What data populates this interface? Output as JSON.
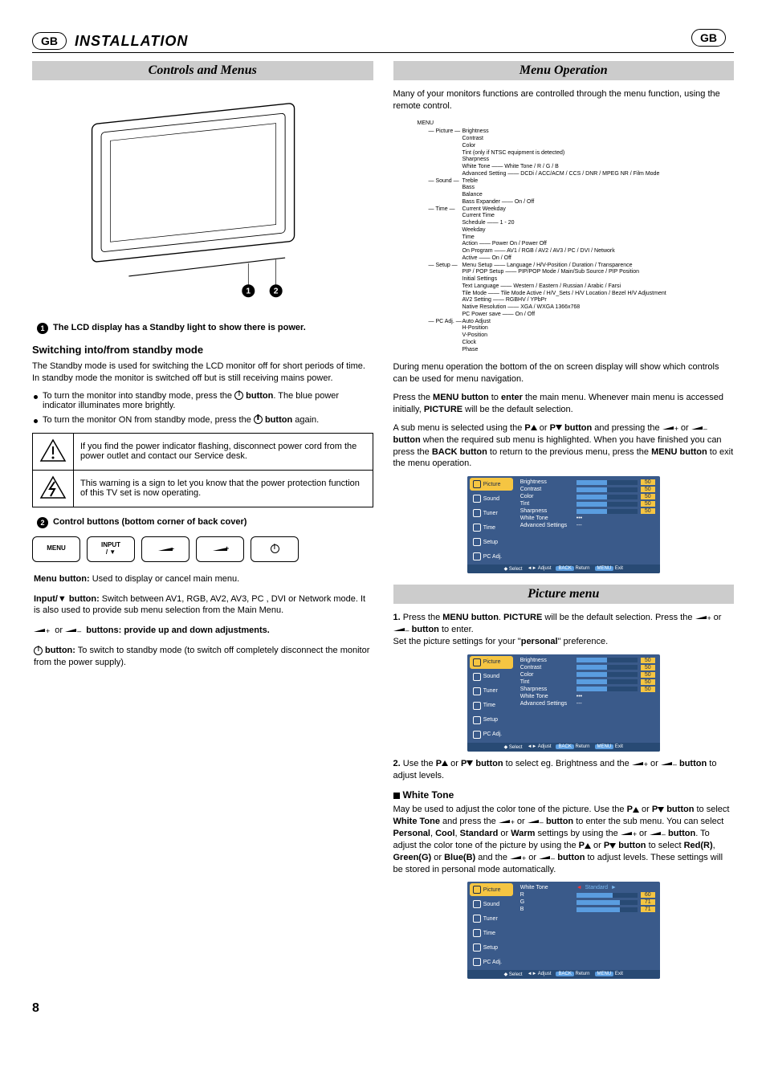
{
  "header": {
    "badge": "GB",
    "title": "INSTALLATION",
    "badge_right": "GB"
  },
  "left": {
    "band": "Controls and Menus",
    "callout1": "The LCD display has a Standby light to show there is power.",
    "sub1": "Switching into/from standby mode",
    "p1": "The Standby mode is used for switching the LCD monitor off for short periods of time. In standby mode the monitor is switched off but is still receiving mains power.",
    "b1a": "To turn the monitor into standby mode, press the ",
    "b1b": " button",
    "b1c": ". The blue power indicator illuminates more brightly.",
    "b2a": "To turn the monitor ON from standby mode, press the ",
    "b2b": " button",
    "b2c": " again.",
    "warn1": "If you find the power indicator flashing, disconnect power cord from the power outlet and contact our Service desk.",
    "warn2": "This warning is a sign to let you know that the power protection function of this TV set is now operating.",
    "callout2": "Control buttons (bottom corner of back cover)",
    "btn_menu": "MENU",
    "btn_input": "INPUT\n/ ▼",
    "d1l": "Menu button:",
    "d1t": " Used to display or cancel main menu.",
    "d2l": "Input/▼ button:",
    "d2t": " Switch between AV1, RGB, AV2, AV3, PC , DVI or Network mode. It is also used to provide sub menu selection from the Main Menu.",
    "d3t": " buttons: provide up and down adjustments.",
    "d4l": " button:",
    "d4t": " To switch to standby mode (to switch off completely disconnect the monitor from the power supply)."
  },
  "right": {
    "band1": "Menu Operation",
    "intro": "Many of your monitors functions are controlled through the menu function, using the remote control.",
    "tree": {
      "root": "MENU",
      "picture": {
        "label": "Picture",
        "items": [
          "Brightness",
          "Contrast",
          "Color",
          "Tint (only if NTSC equipment is detected)",
          "Sharpness",
          "White Tone —— White Tone / R / G / B",
          "Advanced Setting —— DCDi / ACC/ACM / CCS / DNR / MPEG NR / Film Mode"
        ]
      },
      "sound": {
        "label": "Sound",
        "items": [
          "Treble",
          "Bass",
          "Balance",
          "Bass Expander —— On / Off"
        ]
      },
      "time": {
        "label": "Time",
        "items": [
          "Current Weekday",
          "Current Time",
          "Schedule —— 1 - 20",
          "Weekday",
          "Time",
          "Action —— Power On / Power Off",
          "On Program —— AV1 / RGB / AV2 / AV3 / PC / DVI / Network",
          "Active —— On / Off"
        ]
      },
      "setup": {
        "label": "Setup",
        "items": [
          "Menu Setup —— Language / H/V-Position / Duration / Transparence",
          "PIP / POP Setup —— PIP/POP Mode / Main/Sub Source / PIP Position",
          "Initial Settings",
          "Text Language —— Western / Eastern / Russian / Arabic / Farsi",
          "Tile Mode —— Tile Mode Active / H/V_Sets / H/V Location / Bezel H/V Adjustment",
          "AV2 Setting —— RGBHV / YPbPr",
          "Native Resolution —— XGA / WXGA 1366x768",
          "PC Power save —— On / Off"
        ]
      },
      "pcadj": {
        "label": "PC Adj.",
        "items": [
          "Auto Adjust",
          "H-Position",
          "V-Position",
          "Clock",
          "Phase"
        ]
      }
    },
    "after_tree1": "During menu operation the bottom of the on screen display will show which controls can be used for menu navigation.",
    "after_tree2a": "Press the ",
    "after_tree2b": "MENU button",
    "after_tree2c": " to ",
    "after_tree2d": "enter",
    "after_tree2e": " the main menu. Whenever main menu is accessed initially, ",
    "after_tree2f": "PICTURE",
    "after_tree2g": " will be the default selection.",
    "sub_para_a": "A sub menu is selected using the ",
    "sub_para_b": " button",
    "sub_para_c": " and pressing the ",
    "sub_para_d": " button",
    "sub_para_e": " when the required sub menu is highlighted. When you have finished you can press the ",
    "sub_para_f": "BACK button",
    "sub_para_g": " to return to the previous menu, press the ",
    "sub_para_h": "MENU button",
    "sub_para_i": " to exit the menu operation.",
    "osd_tabs": [
      "Picture",
      "Sound",
      "Tuner",
      "Time",
      "Setup",
      "PC Adj."
    ],
    "osd_rows": [
      {
        "lbl": "Brightness",
        "val": "50"
      },
      {
        "lbl": "Contrast",
        "val": "50"
      },
      {
        "lbl": "Color",
        "val": "50"
      },
      {
        "lbl": "Tint",
        "val": "50"
      },
      {
        "lbl": "Sharpness",
        "val": "50"
      }
    ],
    "osd_extra1": "White Tone",
    "osd_extra1v": "•••",
    "osd_extra2": "Advanced Settings",
    "osd_extra2v": "---",
    "osd_foot": [
      "Select",
      "Adjust",
      "BACK",
      "Return",
      "MENU",
      "Exit"
    ],
    "band2": "Picture menu",
    "step1a": "1.",
    "step1b": " Press the ",
    "step1c": "MENU button",
    "step1d": ". ",
    "step1e": "PICTURE",
    "step1f": " will be the default selection. Press the ",
    "step1g": " button",
    "step1h": " to enter.",
    "step1i": "Set the picture settings for your \"",
    "step1j": "personal",
    "step1k": "\" preference.",
    "step2a": "2.",
    "step2b": " Use the ",
    "step2c": " button",
    "step2d": " to select eg. Brightness and the ",
    "step2e": " button",
    "step2f": " to adjust levels.",
    "wt_head": "White Tone",
    "wt_a": "May be used to adjust the color tone of the picture. Use the ",
    "wt_b": " button",
    "wt_c": " to select ",
    "wt_d": "White Tone",
    "wt_e": " and press the ",
    "wt_f": " button",
    "wt_g": " to enter the sub menu. You can select ",
    "wt_h": "Personal",
    "wt_i": ", ",
    "wt_j": "Cool",
    "wt_k": ", ",
    "wt_l": "Standard",
    "wt_m": " or ",
    "wt_n": "Warm",
    "wt_o": " settings by using the ",
    "wt_p": " button",
    "wt_q": ". To adjust the color tone of the picture by using the ",
    "wt_r": " button",
    "wt_s": " to select ",
    "wt_t": "Red(R)",
    "wt_u": ", ",
    "wt_v": "Green(G)",
    "wt_w": " or ",
    "wt_x": "Blue(B)",
    "wt_y": " and the ",
    "wt_z": " button",
    "wt_za": " to adjust levels. These settings will be stored in personal mode automatically.",
    "osd3_rows": [
      {
        "lbl": "White Tone",
        "mode": "select",
        "val": "Standard"
      },
      {
        "lbl": "R",
        "val": "60"
      },
      {
        "lbl": "G",
        "val": "71"
      },
      {
        "lbl": "B",
        "val": "71"
      }
    ]
  },
  "page_num": "8"
}
